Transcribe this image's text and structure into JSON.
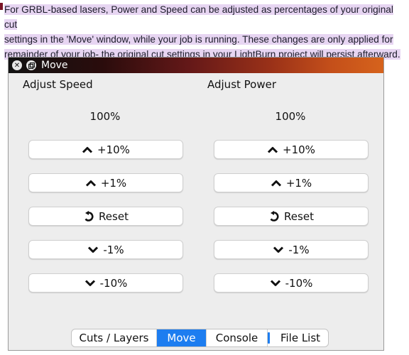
{
  "intro": {
    "line1": "For GRBL-based lasers, Power and Speed can be adjusted as percentages of your original cut",
    "line2": "settings in the 'Move' window, while your job is running. These changes are only applied for",
    "line3": "remainder of your job- the original cut settings in your LightBurn project will persist afterward."
  },
  "window": {
    "title": "Move",
    "close_icon": "close-icon",
    "float_icon": "float-window-icon"
  },
  "speed": {
    "heading": "Adjust Speed",
    "value": "100%",
    "buttons": [
      "+10%",
      "+1%",
      "Reset",
      "-1%",
      "-10%"
    ]
  },
  "power": {
    "heading": "Adjust Power",
    "value": "100%",
    "buttons": [
      "+10%",
      "+1%",
      "Reset",
      "-1%",
      "-10%"
    ]
  },
  "icons": {
    "up": "chevron-up-icon",
    "down": "chevron-down-icon",
    "reset": "reset-icon"
  },
  "tabs": [
    {
      "label": "Cuts / Layers",
      "active": false
    },
    {
      "label": "Move",
      "active": true
    },
    {
      "label": "Console",
      "active": false
    },
    {
      "label": "File List",
      "active": false
    }
  ],
  "colors": {
    "highlight": "#e7d5f2",
    "active_tab": "#1d7df0"
  }
}
